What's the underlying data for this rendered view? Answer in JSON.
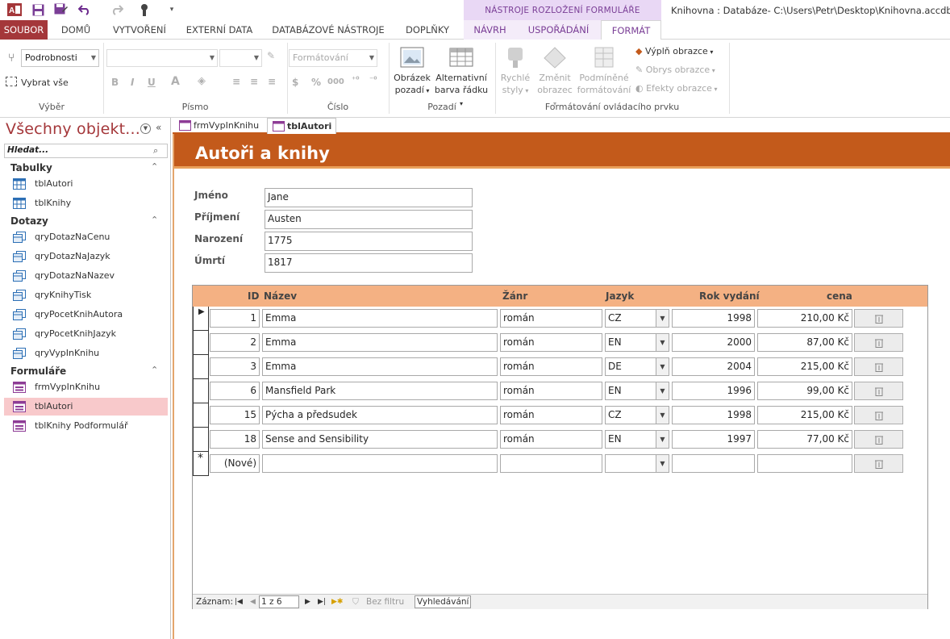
{
  "window": {
    "title": "Knihovna : Databáze- C:\\Users\\Petr\\Desktop\\Knihovna.accdb (For"
  },
  "ribbon_context": {
    "label": "NÁSTROJE ROZLOŽENÍ FORMULÁŘE"
  },
  "ribbon_tabs": {
    "file": "SOUBOR",
    "home": "DOMŮ",
    "create": "VYTVOŘENÍ",
    "external": "EXTERNÍ DATA",
    "dbtools": "DATABÁZOVÉ NÁSTROJE",
    "addins": "DOPLŇKY",
    "design": "NÁVRH",
    "arrange": "USPOŘÁDÁNÍ",
    "format": "FORMÁT"
  },
  "ribbon": {
    "vyber": {
      "combo": "Podrobnosti",
      "select_all": "Vybrat vše",
      "label": "Výběr"
    },
    "pismo": {
      "label": "Písmo"
    },
    "cislo": {
      "format_combo": "Formátování",
      "label": "Číslo"
    },
    "pozadi": {
      "image_line1": "Obrázek",
      "image_line2": "pozadí",
      "alt_line1": "Alternativní",
      "alt_line2": "barva řádku",
      "label": "Pozadí"
    },
    "format_ctrl": {
      "quick_line1": "Rychlé",
      "quick_line2": "styly",
      "change_line1": "Změnit",
      "change_line2": "obrazec",
      "cond_line1": "Podmíněné",
      "cond_line2": "formátování",
      "fill": "Výplň obrazce",
      "outline": "Obrys obrazce",
      "effects": "Efekty obrazce",
      "label": "Formátování ovládacího prvku"
    }
  },
  "nav": {
    "title": "Všechny objekt...",
    "search_placeholder": "Hledat...",
    "categories": [
      {
        "name": "Tabulky",
        "items": [
          "tblAutori",
          "tblKnihy"
        ]
      },
      {
        "name": "Dotazy",
        "items": [
          "qryDotazNaCenu",
          "qryDotazNaJazyk",
          "qryDotazNaNazev",
          "qryKnihyTisk",
          "qryPocetKnihAutora",
          "qryPocetKnihJazyk",
          "qryVypInKnihu"
        ]
      },
      {
        "name": "Formuláře",
        "items": [
          "frmVypInKnihu",
          "tblAutori",
          "tblKnihy Podformulář"
        ]
      }
    ]
  },
  "doc_tabs": [
    "frmVypInKnihu",
    "tblAutori"
  ],
  "form": {
    "title": "Autoři a knihy",
    "fields": [
      {
        "label": "Jméno",
        "value": "Jane"
      },
      {
        "label": "Příjmení",
        "value": "Austen"
      },
      {
        "label": "Narození",
        "value": "1775"
      },
      {
        "label": "Úmrtí",
        "value": "1817"
      }
    ],
    "subform": {
      "columns": [
        "ID",
        "Název",
        "Žánr",
        "Jazyk",
        "Rok vydání",
        "cena"
      ],
      "rows": [
        {
          "id": "1",
          "nazev": "Emma",
          "zanr": "román",
          "jazyk": "CZ",
          "rok": "1998",
          "cena": "210,00 Kč"
        },
        {
          "id": "2",
          "nazev": "Emma",
          "zanr": "román",
          "jazyk": "EN",
          "rok": "2000",
          "cena": "87,00 Kč"
        },
        {
          "id": "3",
          "nazev": "Emma",
          "zanr": "román",
          "jazyk": "DE",
          "rok": "2004",
          "cena": "215,00 Kč"
        },
        {
          "id": "6",
          "nazev": "Mansfield Park",
          "zanr": "román",
          "jazyk": "EN",
          "rok": "1996",
          "cena": "99,00 Kč"
        },
        {
          "id": "15",
          "nazev": "Pýcha a předsudek",
          "zanr": "román",
          "jazyk": "CZ",
          "rok": "1998",
          "cena": "215,00 Kč"
        },
        {
          "id": "18",
          "nazev": "Sense and Sensibility",
          "zanr": "román",
          "jazyk": "EN",
          "rok": "1997",
          "cena": "77,00 Kč"
        }
      ],
      "new_row_label": "(Nové)",
      "record_nav": {
        "label": "Záznam:",
        "position": "1 z 6",
        "filter": "Bez filtru",
        "search": "Vyhledávání"
      }
    }
  },
  "colors": {
    "access_red": "#a4373a",
    "header_orange": "#c35a1b",
    "subform_header": "#f4b183",
    "context_purple": "#7a3e96"
  },
  "icons": [
    "access-logo-icon",
    "save-icon",
    "save-as-icon",
    "undo-icon",
    "redo-icon",
    "touch-mode-icon",
    "customize-qat-icon"
  ]
}
